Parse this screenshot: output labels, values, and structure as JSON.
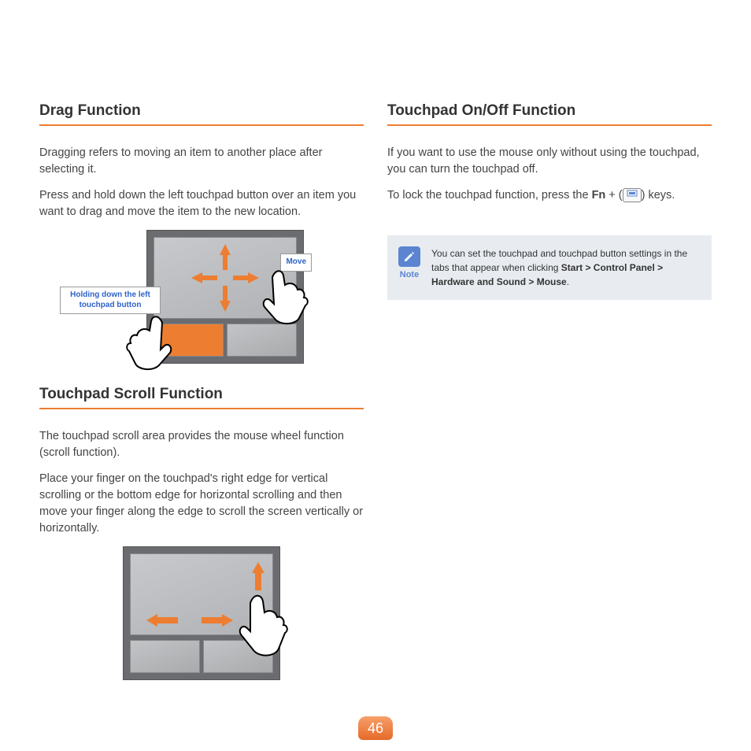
{
  "left": {
    "drag": {
      "heading": "Drag Function",
      "p1": "Dragging refers to moving an item to another place after selecting it.",
      "p2": "Press and hold down the left touchpad button over an item you want to drag and move the item to the new location.",
      "callout_hold": "Holding down the left touchpad button",
      "callout_move": "Move"
    },
    "scroll": {
      "heading": "Touchpad Scroll Function",
      "p1": "The touchpad scroll area provides the mouse wheel function (scroll function).",
      "p2": "Place your finger on the touchpad's right edge for vertical scrolling or the bottom edge for horizontal scrolling and then move your finger along the edge to scroll the screen vertically or horizontally."
    }
  },
  "right": {
    "onoff": {
      "heading": "Touchpad On/Off Function",
      "p1": "If you want to use the mouse only without using the touchpad, you can turn the touchpad off.",
      "p2_pre": "To lock the touchpad function, press the ",
      "fn": "Fn",
      "plus": " + (",
      "key_icon_name": "touchpad-lock-key",
      "p2_post": ") keys."
    },
    "note": {
      "label": "Note",
      "text_pre": "You can set the touchpad and touchpad button settings in the tabs that appear when clicking ",
      "path": "Start > Control Panel > Hardware and Sound > Mouse",
      "text_post": "."
    }
  },
  "page_number": "46"
}
